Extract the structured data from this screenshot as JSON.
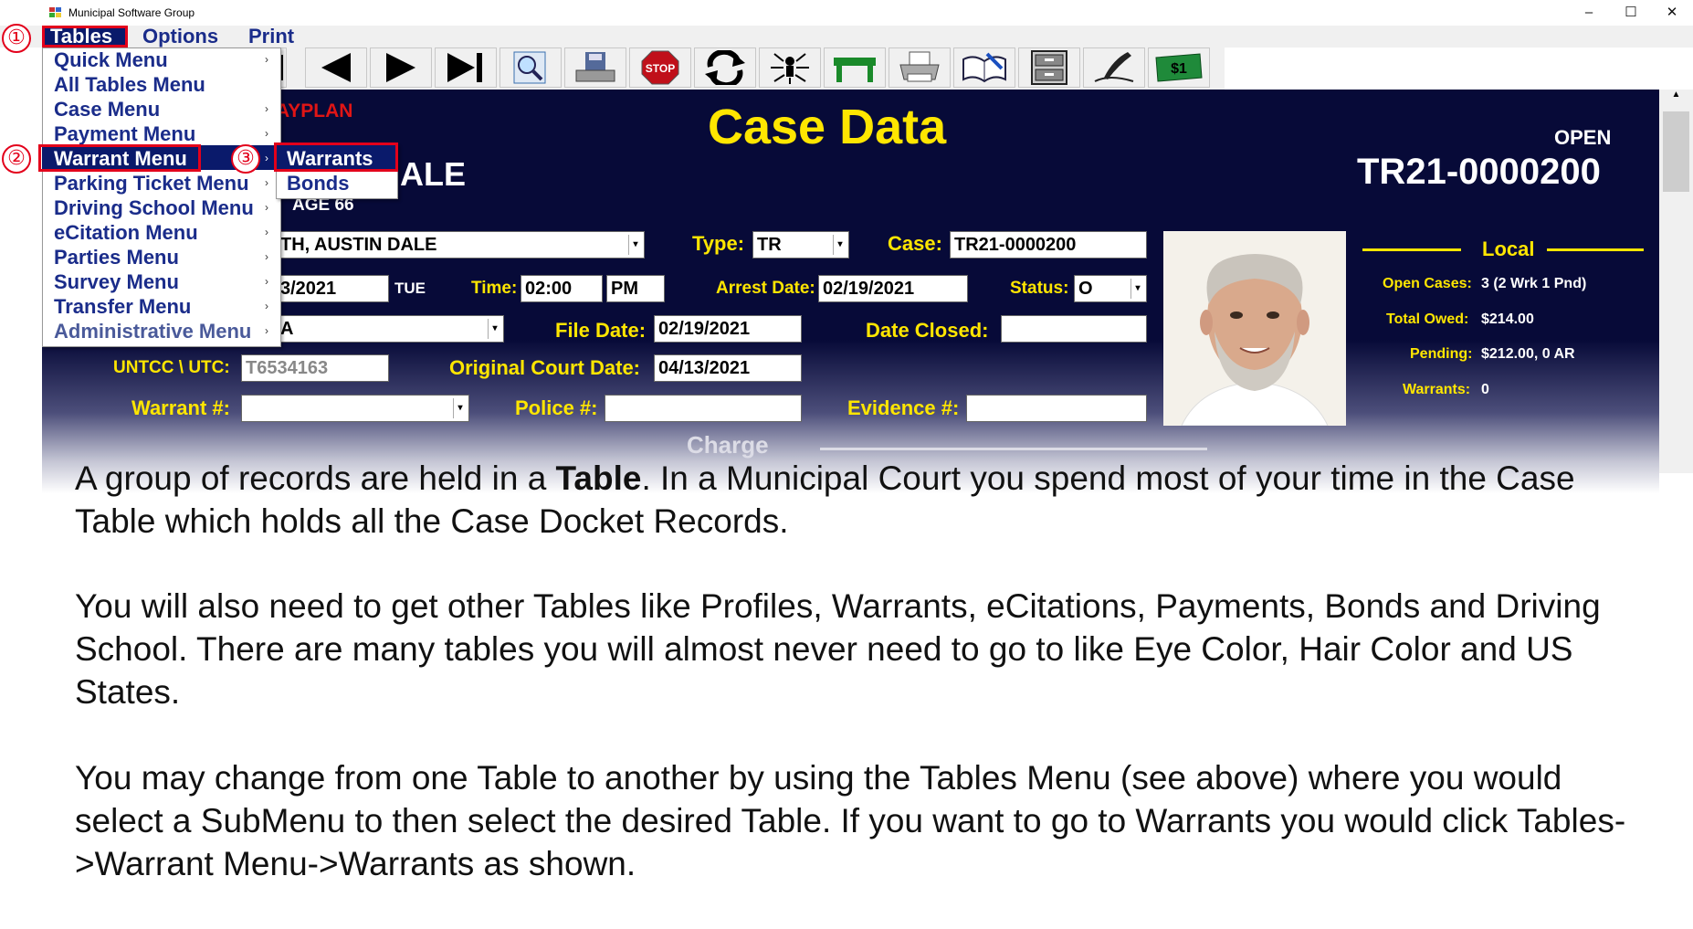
{
  "window": {
    "title": "Municipal Software Group",
    "minimize": "–",
    "maximize": "☐",
    "close": "✕"
  },
  "menubar": {
    "tables": "Tables",
    "options": "Options",
    "print": "Print"
  },
  "toolbar": {
    "buttons": [
      "first-icon",
      "prev-icon",
      "next-icon",
      "last-icon",
      "search-icon",
      "save-icon",
      "stop-icon",
      "refresh-icon",
      "network-icon",
      "table-icon",
      "printer-icon",
      "book-icon",
      "cabinet-icon",
      "pen-icon",
      "money-icon"
    ],
    "stop_label": "STOP",
    "money_label": "$1"
  },
  "tables_menu": {
    "items": [
      "Quick Menu",
      "All Tables Menu",
      "Case Menu",
      "Payment Menu",
      "Warrant Menu",
      "Parking Ticket Menu",
      "Driving School Menu",
      "eCitation Menu",
      "Parties Menu",
      "Survey Menu",
      "Transfer Menu",
      "Administrative Menu"
    ],
    "highlighted": "Warrant Menu"
  },
  "warrant_submenu": {
    "items": [
      "Warrants",
      "Bonds"
    ],
    "highlighted": "Warrants"
  },
  "annotations": {
    "step1": "①",
    "step2": "②",
    "step3": "③"
  },
  "case": {
    "heading": "Case Data",
    "payplan_fragment": "AYPLAN",
    "name_fragment": "ALE",
    "age": "AGE  66",
    "status_word": "OPEN",
    "case_number": "TR21-0000200",
    "party_value": "TH, AUSTIN DALE",
    "type_label": "Type:",
    "type_value": "TR",
    "case_label": "Case:",
    "case_value": "TR21-0000200",
    "date_value": "3/2021",
    "day": "TUE",
    "time_label": "Time:",
    "time_value": "02:00",
    "ampm": "PM",
    "arrest_label": "Arrest Date:",
    "arrest_value": "02/19/2021",
    "status_label": "Status:",
    "status_value": "O",
    "court_value": "A",
    "file_date_label": "File Date:",
    "file_date_value": "02/19/2021",
    "date_closed_label": "Date Closed:",
    "date_closed_value": "",
    "untcc_label": "UNTCC \\ UTC:",
    "untcc_value": "T6534163",
    "orig_court_label": "Original Court Date:",
    "orig_court_value": "04/13/2021",
    "warrant_label": "Warrant #:",
    "warrant_value": "",
    "police_label": "Police #:",
    "police_value": "",
    "evidence_label": "Evidence #:",
    "evidence_value": "",
    "charge_label": "Charge"
  },
  "summary": {
    "title": "Local",
    "open_cases_label": "Open Cases:",
    "open_cases_value": "3 (2 Wrk  1 Pnd)",
    "total_owed_label": "Total Owed:",
    "total_owed_value": "$214.00",
    "pending_label": "Pending:",
    "pending_value": "$212.00,  0 AR",
    "warrants_label": "Warrants:",
    "warrants_value": "0"
  },
  "body": {
    "p1_pre": "A group of records are held in a ",
    "p1_bold": "Table",
    "p1_post": ".   In a Municipal Court you spend most of your time in the Case Table which holds all the Case Docket Records.",
    "p2": "You will also need to get other Tables like Profiles, Warrants, eCitations, Payments,  Bonds and Driving School.  There are many tables you will almost never need to go to like Eye Color, Hair Color and US States.",
    "p3": "You may change from one Table to another by using the Tables Menu (see above) where you would select a SubMenu to then select the desired Table. If you want to go to Warrants you would click  Tables->Warrant Menu->Warrants as shown."
  },
  "colors": {
    "panel": "#070a38",
    "label_yellow": "#ffe600",
    "menu_text": "#1a2c8a",
    "highlight": "#0a1a6b",
    "annotation_red": "#e3001b"
  }
}
